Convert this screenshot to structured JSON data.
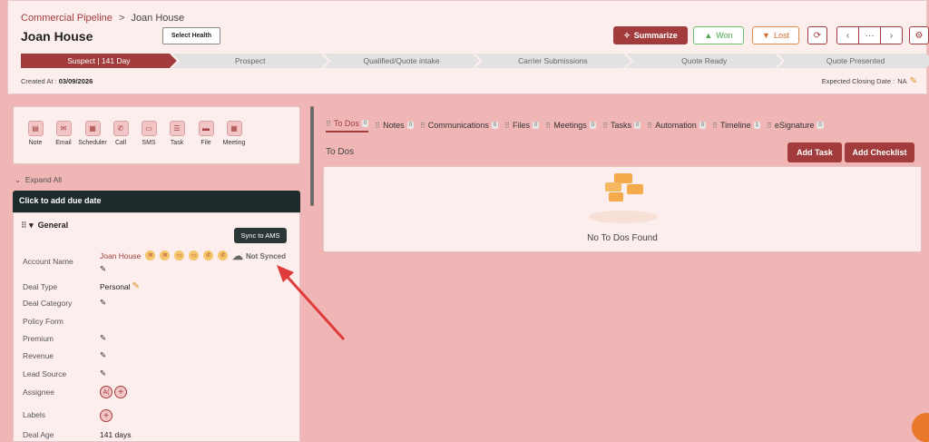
{
  "breadcrumb": {
    "parent": "Commercial Pipeline",
    "separator": ">",
    "current": "Joan House"
  },
  "page_title": "Joan House",
  "select_health_label": "Select Health",
  "header_buttons": {
    "summarize": "Summarize",
    "won": "Won",
    "lost": "Lost",
    "pager_more": "···"
  },
  "stages": [
    "Suspect | 141 Day",
    "Prospect",
    "Qualified/Quote intake",
    "Carrier Submissions",
    "Quote Ready",
    "Quote Presented"
  ],
  "created": {
    "label": "Created At :",
    "value": "03/09/2026"
  },
  "closing": {
    "label": "Expected Closing Date :",
    "value": "NA"
  },
  "actions": [
    "Note",
    "Email",
    "Scheduler",
    "Call",
    "SMS",
    "Task",
    "File",
    "Meeting"
  ],
  "expand_all": "Expand All",
  "due_date": "Click to add due date",
  "general": {
    "title": "General",
    "account_name_label": "Account Name",
    "account_name": "Joan House",
    "sync_tooltip": "Sync to AMS",
    "sync_status": "Not Synced",
    "deal_type_label": "Deal Type",
    "deal_type": "Personal",
    "deal_category_label": "Deal Category",
    "policy_form_label": "Policy Form",
    "premium_label": "Premium",
    "revenue_label": "Revenue",
    "lead_source_label": "Lead Source",
    "assignee_label": "Assignee",
    "assignee_initials": "A(",
    "labels_label": "Labels",
    "deal_age_label": "Deal Age",
    "deal_age": "141 days"
  },
  "tabs": [
    {
      "label": "To Dos",
      "count": "0"
    },
    {
      "label": "Notes",
      "count": "0"
    },
    {
      "label": "Communications",
      "count": "0"
    },
    {
      "label": "Files",
      "count": "0"
    },
    {
      "label": "Meetings",
      "count": "0"
    },
    {
      "label": "Tasks",
      "count": "0"
    },
    {
      "label": "Automation",
      "count": "0"
    },
    {
      "label": "Timeline",
      "count": "1"
    },
    {
      "label": "eSignature",
      "count": "0"
    }
  ],
  "todos": {
    "title": "To Dos",
    "add_task": "Add Task",
    "add_checklist": "Add Checklist",
    "empty": "No To Dos Found"
  }
}
